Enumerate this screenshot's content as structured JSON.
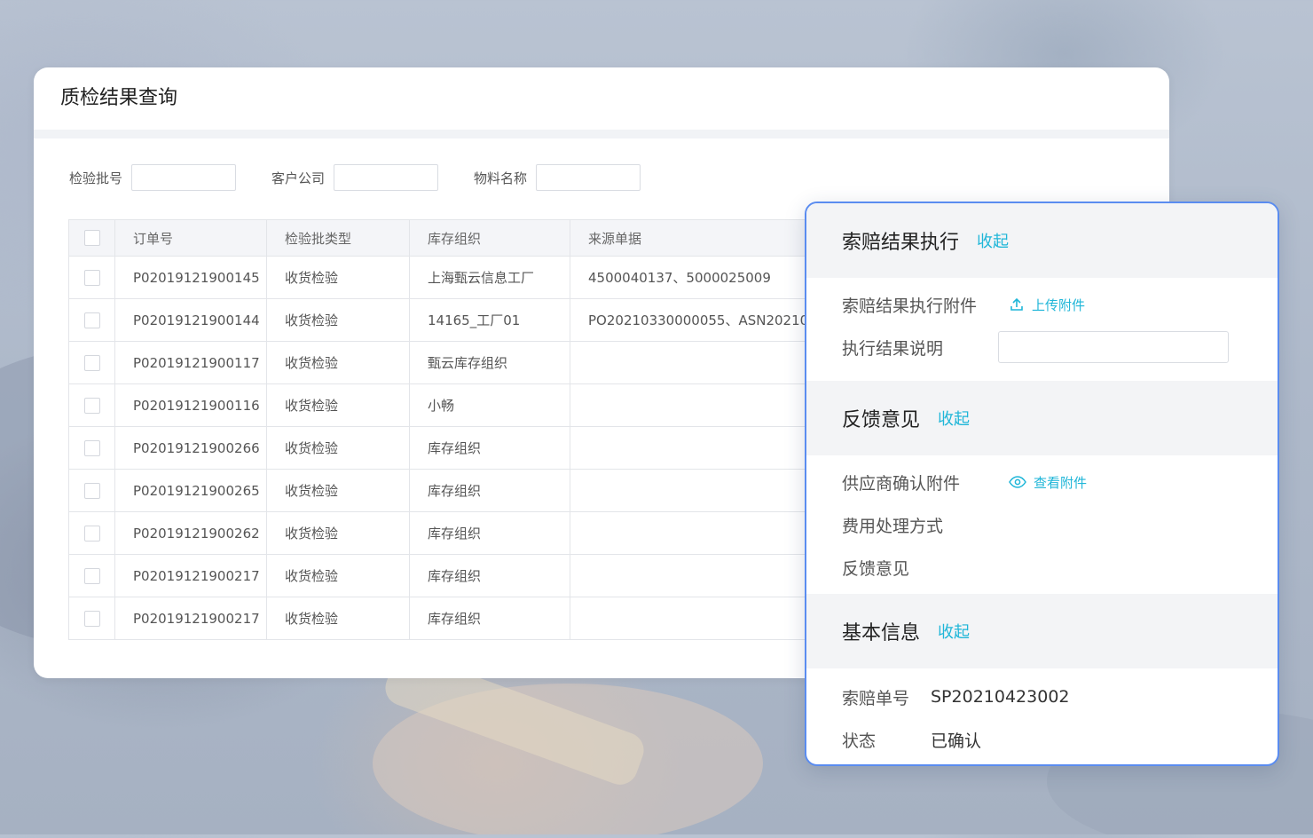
{
  "main": {
    "title": "质检结果查询",
    "filters": [
      {
        "label": "检验批号",
        "value": ""
      },
      {
        "label": "客户公司",
        "value": ""
      },
      {
        "label": "物料名称",
        "value": ""
      }
    ],
    "table": {
      "columns": [
        "订单号",
        "检验批类型",
        "库存组织",
        "来源单据"
      ],
      "rows": [
        {
          "order": "P02019121900145",
          "type": "收货检验",
          "org": "上海甄云信息工厂",
          "source": "4500040137、5000025009"
        },
        {
          "order": "P02019121900144",
          "type": "收货检验",
          "org": "14165_工厂01",
          "source": "PO20210330000055、ASN20210..."
        },
        {
          "order": "P02019121900117",
          "type": "收货检验",
          "org": "甄云库存组织",
          "source": ""
        },
        {
          "order": "P02019121900116",
          "type": "收货检验",
          "org": "小畅",
          "source": ""
        },
        {
          "order": "P02019121900266",
          "type": "收货检验",
          "org": "库存组织",
          "source": ""
        },
        {
          "order": "P02019121900265",
          "type": "收货检验",
          "org": "库存组织",
          "source": ""
        },
        {
          "order": "P02019121900262",
          "type": "收货检验",
          "org": "库存组织",
          "source": ""
        },
        {
          "order": "P02019121900217",
          "type": "收货检验",
          "org": "库存组织",
          "source": ""
        },
        {
          "order": "P02019121900217",
          "type": "收货检验",
          "org": "库存组织",
          "source": ""
        }
      ]
    }
  },
  "side": {
    "claim_exec": {
      "title": "索赔结果执行",
      "collapse": "收起",
      "attachment_label": "索赔结果执行附件",
      "upload_link": "上传附件",
      "desc_label": "执行结果说明",
      "desc_value": ""
    },
    "feedback": {
      "title": "反馈意见",
      "collapse": "收起",
      "supplier_attach_label": "供应商确认附件",
      "view_link": "查看附件",
      "cost_label": "费用处理方式",
      "feedback_label": "反馈意见"
    },
    "basic": {
      "title": "基本信息",
      "collapse": "收起",
      "claim_no_label": "索赔单号",
      "claim_no_value": "SP20210423002",
      "status_label": "状态",
      "status_value": "已确认"
    }
  },
  "colors": {
    "accent_link": "#1fb6d8",
    "panel_border": "#5a8cf0"
  }
}
